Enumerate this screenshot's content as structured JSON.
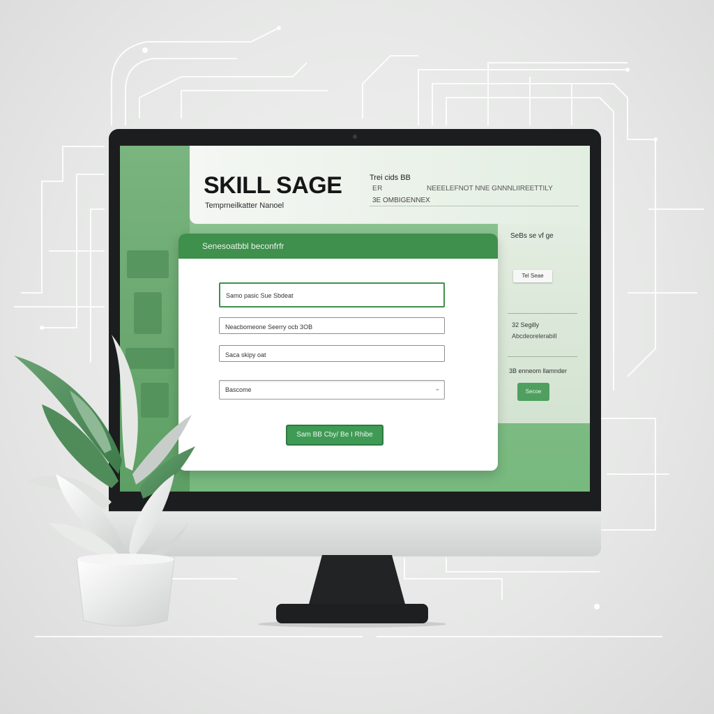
{
  "brand": {
    "name": "SKILL SAGE",
    "tagline": "Temprneilkatter Nanoel"
  },
  "header_right": {
    "line1": "Trei cids BB",
    "line2a": "ER",
    "line2b": "NEEELEFNOT NNE GNNNLIIREETTILY",
    "line3": "3E OMBIGENNEX"
  },
  "form": {
    "title": "Senesoatbbl beconfrfr",
    "fields": [
      {
        "value": "Samo pasic Sue Sbdeat"
      },
      {
        "value": "Neacbomeone Seerry ocb 3OB"
      },
      {
        "value": "Saca skipy oat"
      },
      {
        "value": "Bascome"
      }
    ],
    "submit_label": "Sam BB Cby/ Be I Rhibe"
  },
  "right_panel": {
    "title": "SeBs se vf ge",
    "chip": "Tel Seae",
    "item_a": "32 Segilly",
    "item_b": "Abcdeorelerabill",
    "item_c": "3B enneom llamnder",
    "button": "Secoe"
  },
  "colors": {
    "accent": "#3f8f4d",
    "screen_green": "#7fbc85",
    "bezel": "#1c1d1e",
    "background": "#e6e7e6"
  },
  "icons": {
    "select_chevron": "chevron-down-icon"
  }
}
